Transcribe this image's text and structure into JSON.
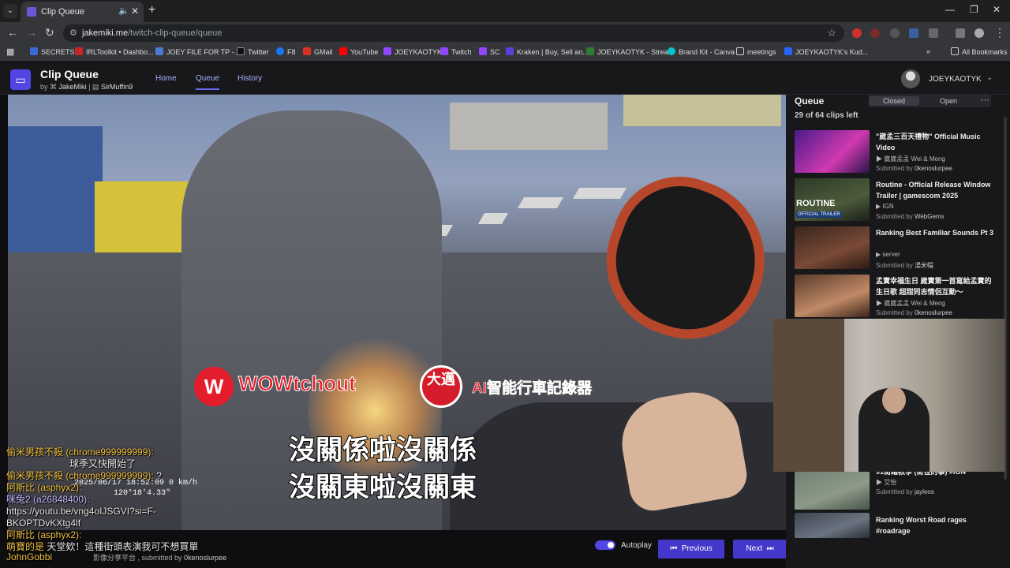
{
  "browser": {
    "tab_title": "Clip Queue",
    "url_host": "jakemiki.me",
    "url_path": "/twitch-clip-queue/queue",
    "bookmarks": [
      "SECRETS",
      "IRLToolkit • Dashbo...",
      "JOEY FILE FOR TP -...",
      "Twitter",
      "F8",
      "GMail",
      "YouTube",
      "JOEYKAOTYK",
      "Twitch",
      "SC",
      "Kraken | Buy, Sell an...",
      "JOEYKAOTYK - Strea...",
      "Brand Kit - Canva",
      "meetings",
      "JOEYKAOTYK's Kud..."
    ],
    "all_bookmarks": "All Bookmarks"
  },
  "app": {
    "title": "Clip Queue",
    "by_prefix": "by",
    "author": "JakeMiki",
    "contributor": "SirMuffin9",
    "nav": {
      "home": "Home",
      "queue": "Queue",
      "history": "History"
    },
    "username": "JOEYKAOTYK"
  },
  "player": {
    "brand_wow": "WOWtchout",
    "brand_big": "大邁",
    "brand_ai": "AI智能行車記錄器",
    "subtitle_1": "沒關係啦沒關係",
    "subtitle_2": "沒關東啦沒關東",
    "osd_1": "2025/06/17 18:52:09   0 km/h",
    "osd_2": "120°18'4.33\"",
    "clip_meta": "影像分享平台 , submitted by",
    "clip_submitter": "0kenoslurpee",
    "autoplay_label": "Autoplay",
    "prev_label": "Previous",
    "next_label": "Next"
  },
  "chat": [
    {
      "user": "偷米男孩不殺 (chrome999999999):",
      "text": ""
    },
    {
      "user": "",
      "text": "球季又快開始了"
    },
    {
      "user": "偷米男孩不殺 (chrome999999999):",
      "text": "?"
    },
    {
      "user": "阿斯比 (asphyx2):",
      "text": ""
    },
    {
      "user": "咪兔2 (a26848400):",
      "text": ""
    },
    {
      "user": "",
      "text": "https://youtu.be/vng4oIJSGVI?si=F-"
    },
    {
      "user": "",
      "text": "BKOPTDvKXtg4lf"
    },
    {
      "user": "阿斯比 (asphyx2):",
      "text": ""
    },
    {
      "user": "萌寶的是",
      "text": "天堂欸！這種街頭表演我可不想買單"
    },
    {
      "user": "JohnGobbi",
      "text": ""
    }
  ],
  "queue": {
    "title": "Queue",
    "tab_closed": "Closed",
    "tab_open": "Open",
    "count_text": "29 of 64 clips left",
    "items": [
      {
        "title": "\"崴孟三百天禮物\" Official Music Video",
        "channel": "崴崴孟孟 Wei & Meng",
        "submitted_prefix": "Submitted by",
        "submitter": "0kenoslurpee"
      },
      {
        "title": "Routine - Official Release Window Trailer | gamescom 2025",
        "channel": "IGN",
        "submitted_prefix": "Submitted by",
        "submitter": "WebGems",
        "thumb_text": "ROUTINE",
        "thumb_badge": "OFFICIAL TRAILER"
      },
      {
        "title": "Ranking Best Familiar Sounds Pt 3",
        "channel": "server",
        "submitted_prefix": "Submitted by",
        "submitter": "湯米帽"
      },
      {
        "title": "孟寶幸福生日 崴寶第一首寫給孟寶的生日歌 超甜同志情侶互動～",
        "channel": "崴崴孟孟 Wei & Meng",
        "submitted_prefix": "Submitted by",
        "submitter": "0kenoslurpee"
      },
      {
        "title": "91街踏教學 (街徑的事) #ION",
        "channel": "艾怡",
        "submitted_prefix": "Submitted by",
        "submitter": "jayleos"
      },
      {
        "title": "Ranking Worst Road rages #roadrage",
        "channel": "",
        "submitted_prefix": "",
        "submitter": ""
      }
    ]
  },
  "colors": {
    "accent": "#4f46e5",
    "brand_red": "#e31d2b",
    "panel": "#18181b"
  }
}
